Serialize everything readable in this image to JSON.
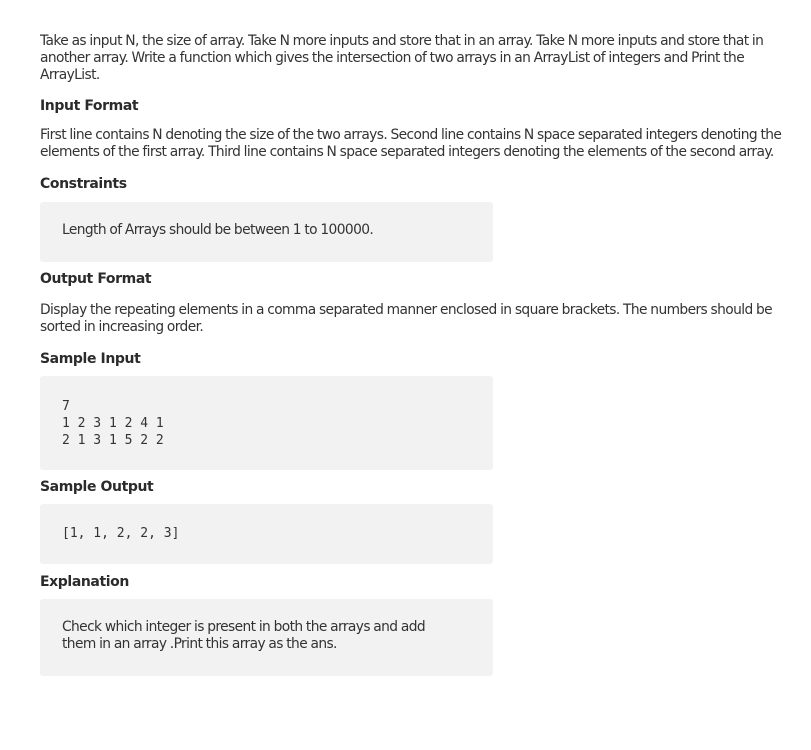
{
  "problem": {
    "statement": "Take as input N, the size of array. Take N more inputs and store that in an array. Take N more inputs and store that in another array. Write a function which gives the intersection of two arrays in an ArrayList of integers and Print the ArrayList."
  },
  "input_format": {
    "heading": "Input Format",
    "text": "First line contains N denoting the size of the two arrays. Second line contains N space separated integers denoting the elements of the first array. Third line contains N space separated integers denoting the elements of the second array."
  },
  "constraints": {
    "heading": "Constraints",
    "text": "Length of Arrays should be between 1 to 100000."
  },
  "output_format": {
    "heading": "Output Format",
    "text": "Display the repeating elements in a comma separated manner enclosed in square brackets. The numbers should be sorted in increasing order."
  },
  "sample_input": {
    "heading": "Sample Input",
    "lines": [
      "7",
      "1 2 3 1 2 4 1",
      "2 1 3 1 5 2 2"
    ]
  },
  "sample_output": {
    "heading": "Sample Output",
    "text": "[1, 1, 2, 2, 3]"
  },
  "explanation": {
    "heading": "Explanation",
    "text": "Check which integer is present in both the arrays and add them in an array .Print this array as the ans."
  }
}
